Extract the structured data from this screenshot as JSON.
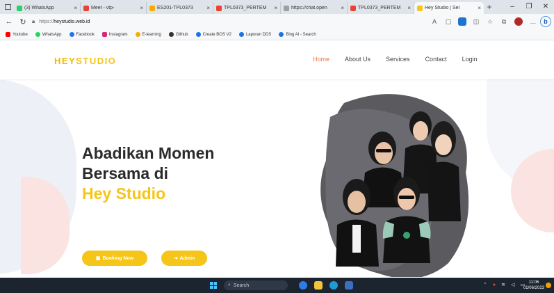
{
  "browser": {
    "tabs": [
      {
        "label": "(3) WhatsApp",
        "color": "#25d366"
      },
      {
        "label": "Meet - vtp-",
        "color": "#ea4335"
      },
      {
        "label": "ES201-TPL0373",
        "color": "#f9ab00"
      },
      {
        "label": "TPL0373_PERTEM",
        "color": "#ea4335"
      },
      {
        "label": "https://chat.open",
        "color": "#9aa0a6"
      },
      {
        "label": "TPL0373_PERTEM",
        "color": "#ea4335"
      },
      {
        "label": "Hey Studio | Sel",
        "color": "#f5c518"
      }
    ],
    "url_scheme": "https://",
    "url_host": "heystudio.web.id",
    "bookmarks": [
      {
        "label": "Youtube",
        "color": "#ff0000"
      },
      {
        "label": "WhatsApp",
        "color": "#25d366"
      },
      {
        "label": "Facebook",
        "color": "#1877f2"
      },
      {
        "label": "Instagram",
        "color": "#d62976"
      },
      {
        "label": "E-learning",
        "color": "#f9ab00"
      },
      {
        "label": "Github",
        "color": "#333333"
      },
      {
        "label": "Create BOS V2",
        "color": "#1a73e8"
      },
      {
        "label": "Laporan DDS",
        "color": "#1a73e8"
      },
      {
        "label": "Bing AI - Search",
        "color": "#1a73e8"
      }
    ]
  },
  "site": {
    "brand_a": "HEY",
    "brand_b": "STUDIO",
    "nav": [
      "Home",
      "About Us",
      "Services",
      "Contact",
      "Login"
    ],
    "headline_line1": "Abadikan Momen",
    "headline_line2": "Bersama di",
    "headline_line3": "Hey Studio",
    "btn_booking": "Booking Now",
    "btn_admin": "Admin",
    "accent": "#f5c518",
    "nav_active_color": "#f07452"
  },
  "taskbar": {
    "search_label": "Search",
    "time": "11:06",
    "date": "01/06/2023"
  }
}
